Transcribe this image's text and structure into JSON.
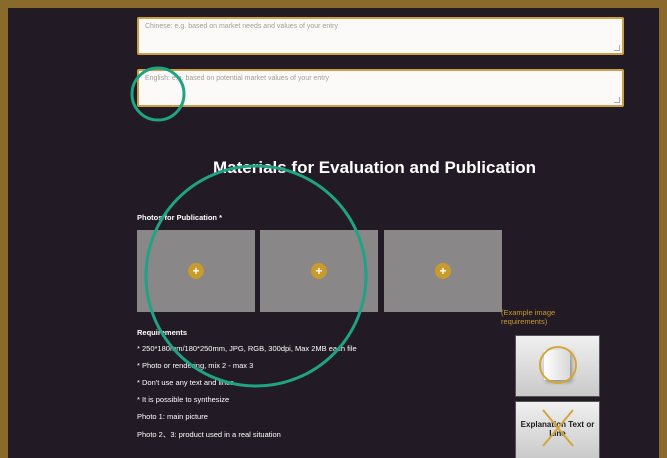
{
  "form": {
    "chinese_placeholder": "Chinese: e.g. based on market needs and values of your entry",
    "english_placeholder": "English: e.g. based on potential market values of your entry"
  },
  "section": {
    "title": "Materials for Evaluation and Publication"
  },
  "photos": {
    "label": "Photos for Publication *",
    "add_icon": "plus-icon",
    "add_symbol": "+"
  },
  "requirements": {
    "title": "Requirements",
    "items": [
      "* 250*180mm/180*250mm, JPG, RGB, 300dpi, Max 2MB each file",
      "* Photo or rendering, mix 2 - max 3",
      "* Don't use any text and lines",
      "* It is possible to synthesize",
      "Photo 1: main picture",
      "Photo 2、3: product used in a real situation"
    ]
  },
  "example": {
    "label": "(Example image requirements)",
    "explanation_text": "Explanation Text or Line"
  },
  "colors": {
    "background": "#221b26",
    "accent": "#c99a2c",
    "highlight_circle": "#1fa383"
  }
}
